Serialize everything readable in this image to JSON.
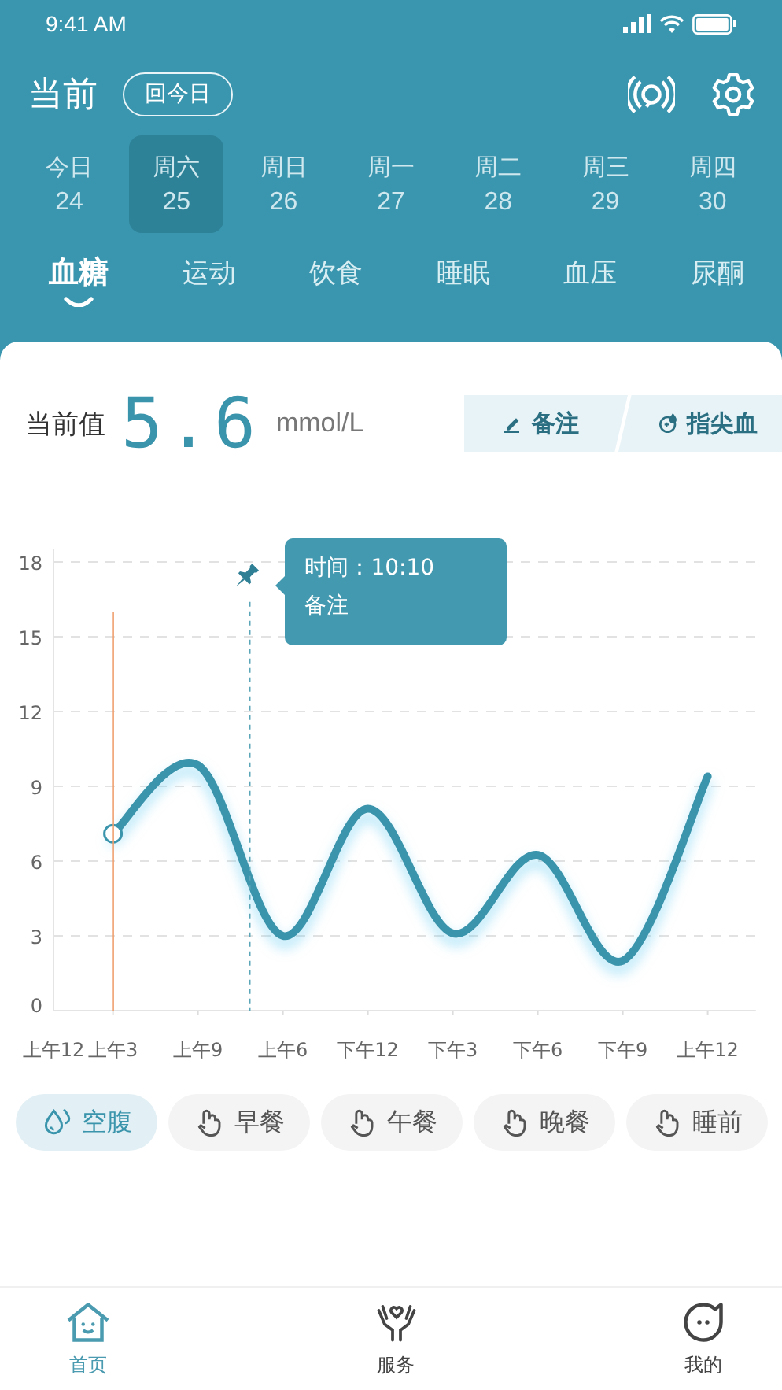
{
  "status_bar": {
    "time": "9:41 AM"
  },
  "header": {
    "title": "当前",
    "today_button": "回今日"
  },
  "dates": [
    {
      "day": "今日",
      "date": "24",
      "selected": false
    },
    {
      "day": "周六",
      "date": "25",
      "selected": true
    },
    {
      "day": "周日",
      "date": "26",
      "selected": false
    },
    {
      "day": "周一",
      "date": "27",
      "selected": false
    },
    {
      "day": "周二",
      "date": "28",
      "selected": false
    },
    {
      "day": "周三",
      "date": "29",
      "selected": false
    },
    {
      "day": "周四",
      "date": "30",
      "selected": false
    }
  ],
  "tabs": [
    {
      "label": "血糖",
      "selected": true
    },
    {
      "label": "运动",
      "selected": false
    },
    {
      "label": "饮食",
      "selected": false
    },
    {
      "label": "睡眠",
      "selected": false
    },
    {
      "label": "血压",
      "selected": false
    },
    {
      "label": "尿酮",
      "selected": false
    }
  ],
  "reading": {
    "label": "当前值",
    "value": "5.6",
    "unit": "mmol/L"
  },
  "actions": [
    {
      "kind": "note",
      "label": "备注"
    },
    {
      "kind": "blood",
      "label": "指尖血"
    }
  ],
  "chart": {
    "chart_data": {
      "type": "line",
      "categories": [
        "上午12",
        "上午3",
        "上午9",
        "上午6",
        "下午12",
        "下午3",
        "下午6",
        "下午9",
        "上午12"
      ],
      "series": [
        {
          "color": "#3a94ab",
          "values": [
            null,
            7.1,
            9.85,
            3.0,
            8.1,
            3.1,
            6.25,
            2.0,
            9.4
          ]
        }
      ],
      "ylim": [
        0,
        18
      ],
      "yticks": [
        0,
        3,
        6,
        9,
        12,
        15,
        18
      ],
      "grid": true,
      "annotations": [
        "时间：10:10",
        "备注"
      ]
    }
  },
  "meals": [
    {
      "kind": "drops",
      "label": "空腹",
      "selected": true
    },
    {
      "kind": "hand",
      "label": "早餐",
      "selected": false
    },
    {
      "kind": "hand",
      "label": "午餐",
      "selected": false
    },
    {
      "kind": "hand",
      "label": "晚餐",
      "selected": false
    },
    {
      "kind": "hand",
      "label": "睡前",
      "selected": false
    }
  ],
  "nav": [
    {
      "kind": "home",
      "label": "首页",
      "selected": true
    },
    {
      "kind": "care",
      "label": "服务",
      "selected": false
    },
    {
      "kind": "me",
      "label": "我的",
      "selected": false
    }
  ]
}
